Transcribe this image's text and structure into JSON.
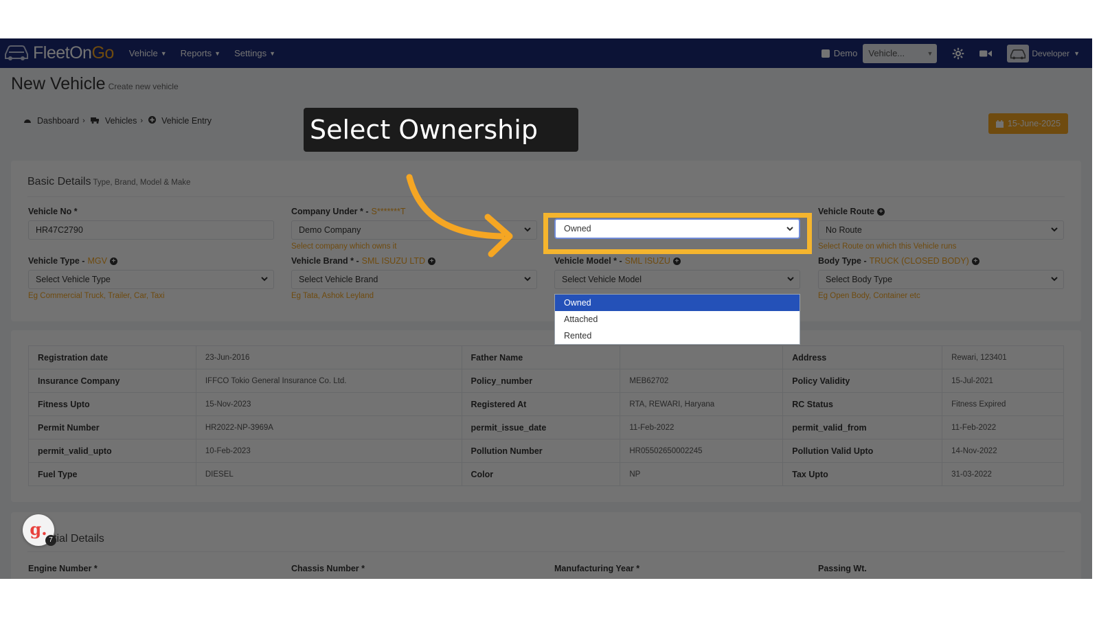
{
  "app": {
    "logo_main": "FleetOn",
    "logo_accent": "Go"
  },
  "nav": {
    "menu": [
      {
        "label": "Vehicle"
      },
      {
        "label": "Reports"
      },
      {
        "label": "Settings"
      }
    ],
    "demo_label": "Demo",
    "vehicle_select": "Vehicle...",
    "user": "Developer"
  },
  "page": {
    "title": "New Vehicle",
    "subtitle": "Create new vehicle"
  },
  "breadcrumb": [
    {
      "label": "Dashboard",
      "icon": "dashboard-icon"
    },
    {
      "label": "Vehicles",
      "icon": "truck-icon"
    },
    {
      "label": "Vehicle Entry",
      "icon": "plus-circle-icon"
    }
  ],
  "date_button": "15-June-2025",
  "basic": {
    "title": "Basic Details",
    "subtitle": "Type, Brand, Model & Make",
    "vehicle_no": {
      "label": "Vehicle No *",
      "value": "HR47C2790"
    },
    "company": {
      "label": "Company Under * -",
      "hint": "S*******T",
      "value": "Demo Company",
      "help": "Select company which owns it"
    },
    "ownership": {
      "value": "Owned"
    },
    "route": {
      "label": "Vehicle Route",
      "value": "No Route",
      "help": "Select Route on which this Vehicle runs"
    },
    "vehicle_type": {
      "label": "Vehicle Type -",
      "hint": "MGV",
      "value": "Select Vehicle Type",
      "help": "Eg Commercial Truck, Trailer, Car, Taxi"
    },
    "brand": {
      "label": "Vehicle Brand * -",
      "hint": "SML ISUZU LTD",
      "value": "Select Vehicle Brand",
      "help": "Eg Tata, Ashok Leyland"
    },
    "model": {
      "label": "Vehicle Model * -",
      "hint": "SML ISUZU",
      "value": "Select Vehicle Model"
    },
    "body": {
      "label": "Body Type -",
      "hint": "TRUCK (CLOSED BODY)",
      "value": "Select Body Type",
      "help": "Eg Open Body, Container etc"
    }
  },
  "ownership_options": [
    "Owned",
    "Attached",
    "Rented"
  ],
  "details_table": [
    [
      "Registration date",
      "23-Jun-2016",
      "Father Name",
      "",
      "Address",
      "Rewari, 123401"
    ],
    [
      "Insurance Company",
      "IFFCO Tokio General Insurance Co. Ltd.",
      "Policy_number",
      "MEB62702",
      "Policy Validity",
      "15-Jul-2021"
    ],
    [
      "Fitness Upto",
      "15-Nov-2023",
      "Registered At",
      "RTA, REWARI, Haryana",
      "RC Status",
      "Fitness Expired"
    ],
    [
      "Permit Number",
      "HR2022-NP-3969A",
      "permit_issue_date",
      "11-Feb-2022",
      "permit_valid_from",
      "11-Feb-2022"
    ],
    [
      "permit_valid_upto",
      "10-Feb-2023",
      "Pollution Number",
      "HR05502650002245",
      "Pollution Valid Upto",
      "14-Nov-2022"
    ],
    [
      "Fuel Type",
      "DIESEL",
      "Color",
      "NP",
      "Tax Upto",
      "31-03-2022"
    ]
  ],
  "technical": {
    "title_visible": "tial Details",
    "fields": [
      "Engine Number *",
      "Chassis Number *",
      "Manufacturing Year *",
      "Passing Wt."
    ]
  },
  "callout": "Select Ownership",
  "badge": {
    "letter": "g.",
    "count": "7"
  },
  "colors": {
    "navbar": "#1b2a78",
    "accent": "#f5a623",
    "highlight": "#f5b52e",
    "selected_option": "#2451b8"
  }
}
